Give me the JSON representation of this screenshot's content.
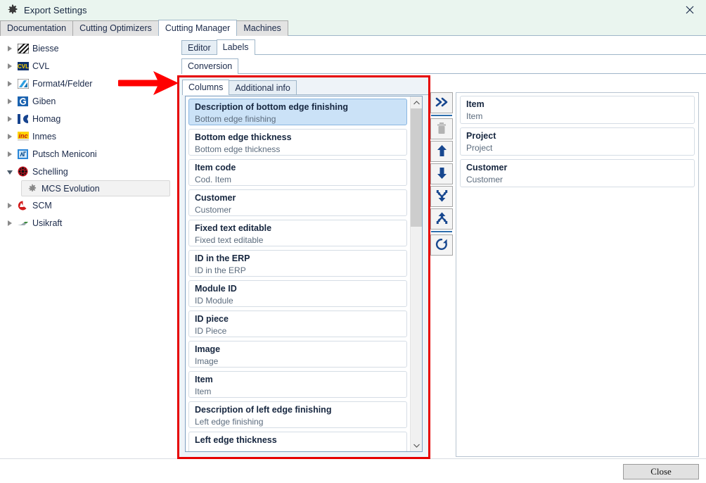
{
  "window": {
    "title": "Export Settings",
    "gear_icon": "gear-icon",
    "close_icon": "close-icon"
  },
  "main_tabs": [
    {
      "label": "Documentation",
      "active": false
    },
    {
      "label": "Cutting Optimizers",
      "active": false
    },
    {
      "label": "Cutting Manager",
      "active": true
    },
    {
      "label": "Machines",
      "active": false
    }
  ],
  "tree": {
    "items": [
      {
        "label": "Biesse",
        "icon": "biesse-logo-icon",
        "expandable": true,
        "expanded": false,
        "child": false,
        "selected": false
      },
      {
        "label": "CVL",
        "icon": "cvl-logo-icon",
        "expandable": true,
        "expanded": false,
        "child": false,
        "selected": false
      },
      {
        "label": "Format4/Felder",
        "icon": "format4-logo-icon",
        "expandable": true,
        "expanded": false,
        "child": false,
        "selected": false
      },
      {
        "label": "Giben",
        "icon": "giben-logo-icon",
        "expandable": true,
        "expanded": false,
        "child": false,
        "selected": false
      },
      {
        "label": "Homag",
        "icon": "homag-logo-icon",
        "expandable": true,
        "expanded": false,
        "child": false,
        "selected": false
      },
      {
        "label": "Inmes",
        "icon": "inmes-logo-icon",
        "expandable": true,
        "expanded": false,
        "child": false,
        "selected": false
      },
      {
        "label": "Putsch Meniconi",
        "icon": "putsch-logo-icon",
        "expandable": true,
        "expanded": false,
        "child": false,
        "selected": false
      },
      {
        "label": "Schelling",
        "icon": "schelling-logo-icon",
        "expandable": true,
        "expanded": true,
        "child": false,
        "selected": false
      },
      {
        "label": "MCS Evolution",
        "icon": "gear-icon",
        "expandable": false,
        "expanded": false,
        "child": true,
        "selected": true
      },
      {
        "label": "SCM",
        "icon": "scm-logo-icon",
        "expandable": true,
        "expanded": false,
        "child": false,
        "selected": false
      },
      {
        "label": "Usikraft",
        "icon": "usikraft-logo-icon",
        "expandable": true,
        "expanded": false,
        "child": false,
        "selected": false
      }
    ]
  },
  "editor_tabs": [
    {
      "label": "Editor",
      "active": false
    },
    {
      "label": "Labels",
      "active": true
    }
  ],
  "conversion_tabs": [
    {
      "label": "Conversion",
      "active": true
    }
  ],
  "columns_tabs": [
    {
      "label": "Columns",
      "active": true
    },
    {
      "label": "Additional info",
      "active": false
    }
  ],
  "available_columns": [
    {
      "title": "Description of bottom edge finishing",
      "subtitle": "Bottom edge finishing",
      "selected": true
    },
    {
      "title": "Bottom edge thickness",
      "subtitle": "Bottom edge thickness",
      "selected": false
    },
    {
      "title": "Item code",
      "subtitle": "Cod. Item",
      "selected": false
    },
    {
      "title": "Customer",
      "subtitle": "Customer",
      "selected": false
    },
    {
      "title": "Fixed text editable",
      "subtitle": "Fixed text editable",
      "selected": false
    },
    {
      "title": "ID in the ERP",
      "subtitle": "ID in the ERP",
      "selected": false
    },
    {
      "title": "Module ID",
      "subtitle": "ID Module",
      "selected": false
    },
    {
      "title": "ID piece",
      "subtitle": "ID Piece",
      "selected": false
    },
    {
      "title": "Image",
      "subtitle": "Image",
      "selected": false
    },
    {
      "title": "Item",
      "subtitle": "Item",
      "selected": false
    },
    {
      "title": "Description of left edge finishing",
      "subtitle": "Left edge finishing",
      "selected": false
    },
    {
      "title": "Left edge thickness",
      "subtitle": "",
      "selected": false
    }
  ],
  "selected_columns": [
    {
      "title": "Item",
      "subtitle": "Item"
    },
    {
      "title": "Project",
      "subtitle": "Project"
    },
    {
      "title": "Customer",
      "subtitle": "Customer"
    }
  ],
  "toolbar_buttons": [
    {
      "name": "add-all-button",
      "icon": "double-chevron-right-icon",
      "enabled": true
    },
    {
      "name": "delete-button",
      "icon": "trash-icon",
      "enabled": false
    },
    {
      "name": "move-up-button",
      "icon": "arrow-up-icon",
      "enabled": true
    },
    {
      "name": "move-down-button",
      "icon": "arrow-down-icon",
      "enabled": true
    },
    {
      "name": "merge-button",
      "icon": "merge-down-icon",
      "enabled": true
    },
    {
      "name": "split-button",
      "icon": "split-up-icon",
      "enabled": true
    },
    {
      "name": "refresh-button",
      "icon": "refresh-icon",
      "enabled": true
    }
  ],
  "footer": {
    "close_label": "Close"
  },
  "annotation": {
    "type": "red-arrow-and-box",
    "arrow_color": "#FF0000",
    "box_color": "#E60000"
  },
  "colors": {
    "titlebar_bg": "#EAF5EF",
    "selected_item_bg": "#CBE2F7",
    "panel_bg": "#EEF3F8",
    "accent": "#2F6FAD"
  },
  "scrollbar": {
    "up_arrow": "▲",
    "down_arrow": "▼"
  }
}
